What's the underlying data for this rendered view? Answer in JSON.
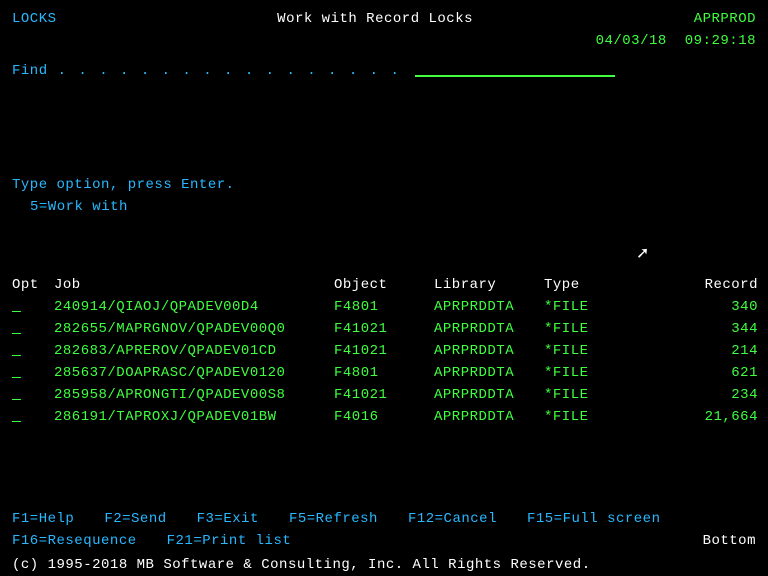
{
  "header": {
    "left": "LOCKS",
    "title": "Work with Record Locks",
    "system": "APRPROD",
    "date": "04/03/18",
    "time": "09:29:18"
  },
  "find": {
    "label": "Find",
    "dots": ". . . . . . . . . . . . . . . . ."
  },
  "instr": {
    "line1": "Type option, press Enter.",
    "line2": "5=Work with"
  },
  "columns": {
    "opt": "Opt",
    "job": "Job",
    "object": "Object",
    "library": "Library",
    "type": "Type",
    "record": "Record"
  },
  "rows": [
    {
      "opt": "_",
      "job": "240914/QIAOJ/QPADEV00D4",
      "object": "F4801",
      "library": "APRPRDDTA",
      "type": "*FILE",
      "record": "340"
    },
    {
      "opt": "_",
      "job": "282655/MAPRGNOV/QPADEV00Q0",
      "object": "F41021",
      "library": "APRPRDDTA",
      "type": "*FILE",
      "record": "344"
    },
    {
      "opt": "_",
      "job": "282683/APREROV/QPADEV01CD",
      "object": "F41021",
      "library": "APRPRDDTA",
      "type": "*FILE",
      "record": "214"
    },
    {
      "opt": "_",
      "job": "285637/DOAPRASC/QPADEV0120",
      "object": "F4801",
      "library": "APRPRDDTA",
      "type": "*FILE",
      "record": "621"
    },
    {
      "opt": "_",
      "job": "285958/APRONGTI/QPADEV00S8",
      "object": "F41021",
      "library": "APRPRDDTA",
      "type": "*FILE",
      "record": "234"
    },
    {
      "opt": "_",
      "job": "286191/TAPROXJ/QPADEV01BW",
      "object": "F4016",
      "library": "APRPRDDTA",
      "type": "*FILE",
      "record": "21,664"
    }
  ],
  "fkeys": {
    "f1": "F1=Help",
    "f2": "F2=Send",
    "f3": "F3=Exit",
    "f5": "F5=Refresh",
    "f12": "F12=Cancel",
    "f15": "F15=Full screen",
    "f16": "F16=Resequence",
    "f21": "F21=Print list",
    "position": "Bottom"
  },
  "copyright": "(c) 1995-2018 MB Software & Consulting, Inc.  All Rights Reserved."
}
